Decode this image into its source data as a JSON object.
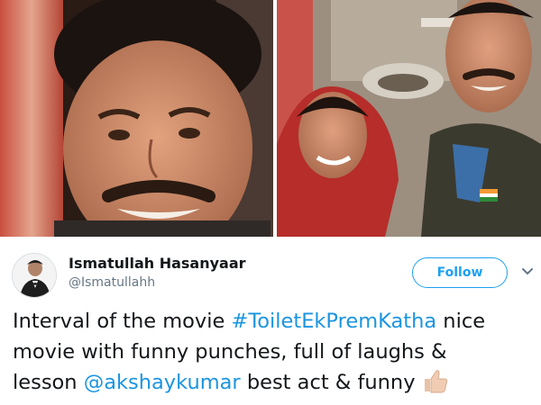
{
  "user": {
    "display_name": "Ismatullah Hasanyaar",
    "handle": "@Ismatullahh"
  },
  "follow_label": "Follow",
  "tweet": {
    "line1_text": "Interval of the movie ",
    "hashtag": "#ToiletEkPremKatha",
    "line1_tail": " nice",
    "line2": "movie with funny punches, full of laughs &",
    "line3_head": "lesson ",
    "mention": "@akshaykumar",
    "line3_tail": " best act & funny"
  },
  "icons": {
    "caret": "chevron-down-icon",
    "emoji": "thumbs-up-emoji"
  },
  "colors": {
    "accent": "#1da1f2",
    "link": "#1b95e0",
    "text": "#14171a",
    "muted": "#657786"
  }
}
